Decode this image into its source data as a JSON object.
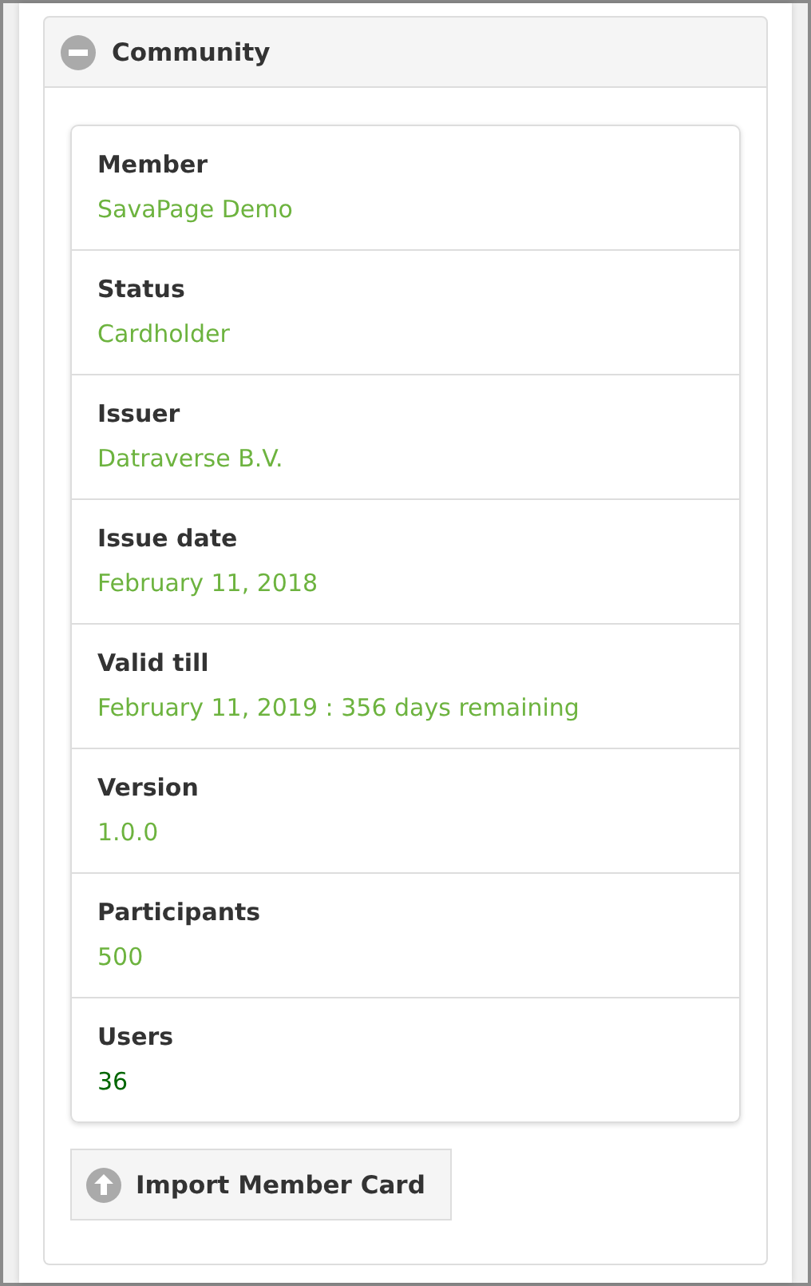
{
  "section": {
    "title": "Community",
    "expanded": true
  },
  "fields": [
    {
      "label": "Member",
      "value": "SavaPage Demo",
      "color": "#6db33f"
    },
    {
      "label": "Status",
      "value": "Cardholder",
      "color": "#6db33f"
    },
    {
      "label": "Issuer",
      "value": "Datraverse B.V.",
      "color": "#6db33f"
    },
    {
      "label": "Issue date",
      "value": "February 11, 2018",
      "color": "#6db33f"
    },
    {
      "label": "Valid till",
      "value": "February 11, 2019 : 356 days remaining",
      "color": "#6db33f"
    },
    {
      "label": "Version",
      "value": "1.0.0",
      "color": "#6db33f"
    },
    {
      "label": "Participants",
      "value": "500",
      "color": "#6db33f"
    },
    {
      "label": "Users",
      "value": "36",
      "color": "#006600"
    }
  ],
  "button": {
    "label": "Import Member Card"
  }
}
